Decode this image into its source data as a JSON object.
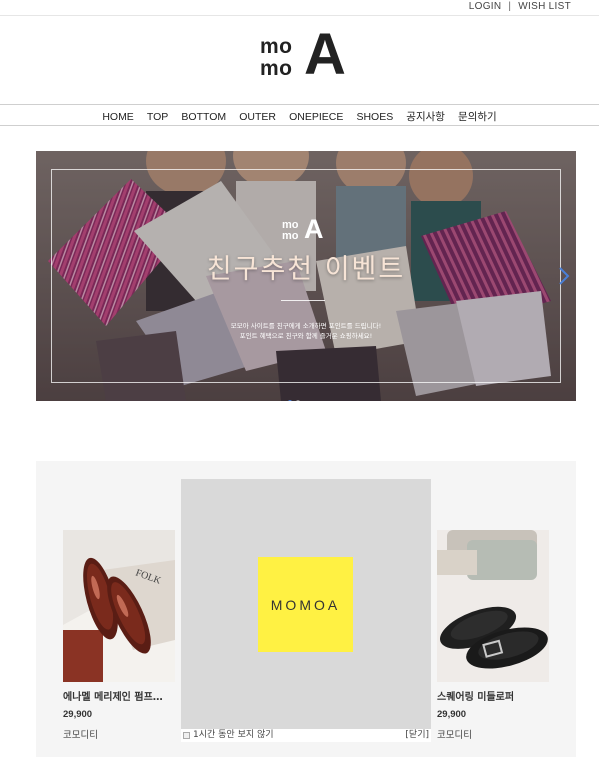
{
  "header": {
    "login_label": "LOGIN",
    "separator": "|",
    "wishlist_label": "WISH LIST"
  },
  "logo": {
    "line1": "mo",
    "line2": "mo",
    "big_letter": "A"
  },
  "nav": {
    "items": [
      {
        "label": "HOME"
      },
      {
        "label": "TOP"
      },
      {
        "label": "BOTTOM"
      },
      {
        "label": "OUTER"
      },
      {
        "label": "ONEPIECE"
      },
      {
        "label": "SHOES"
      },
      {
        "label": "공지사항"
      },
      {
        "label": "문의하기"
      }
    ]
  },
  "banner": {
    "logo_line1": "mo",
    "logo_line2": "mo",
    "logo_big_letter": "A",
    "headline": "친구추천 이벤트",
    "description_line1": "모모아 사이트를 친구에게 소개하면 포인트를 드립니다!",
    "description_line2": "포인트 혜택으로 친구와 함께 즐거운 쇼핑하세요!",
    "slide_count": 2,
    "active_slide": 1,
    "arrow_icon": "chevron-right-icon",
    "accent_color": "#4a7fd6"
  },
  "products": [
    {
      "name": "에나멜 메리제인 펌프…",
      "price": "29,900",
      "brand": "코모디티",
      "image_icon": "enamel-shoes-image"
    },
    {
      "name": "스퀘어링 미들로퍼",
      "price": "29,900",
      "brand": "코모디티",
      "image_icon": "loafer-shoes-image"
    }
  ],
  "popup": {
    "brand_text": "MOMOA",
    "brand_color": "#fff143",
    "hide_label": "1시간 동안 보지 않기",
    "close_label": "[닫기]"
  }
}
